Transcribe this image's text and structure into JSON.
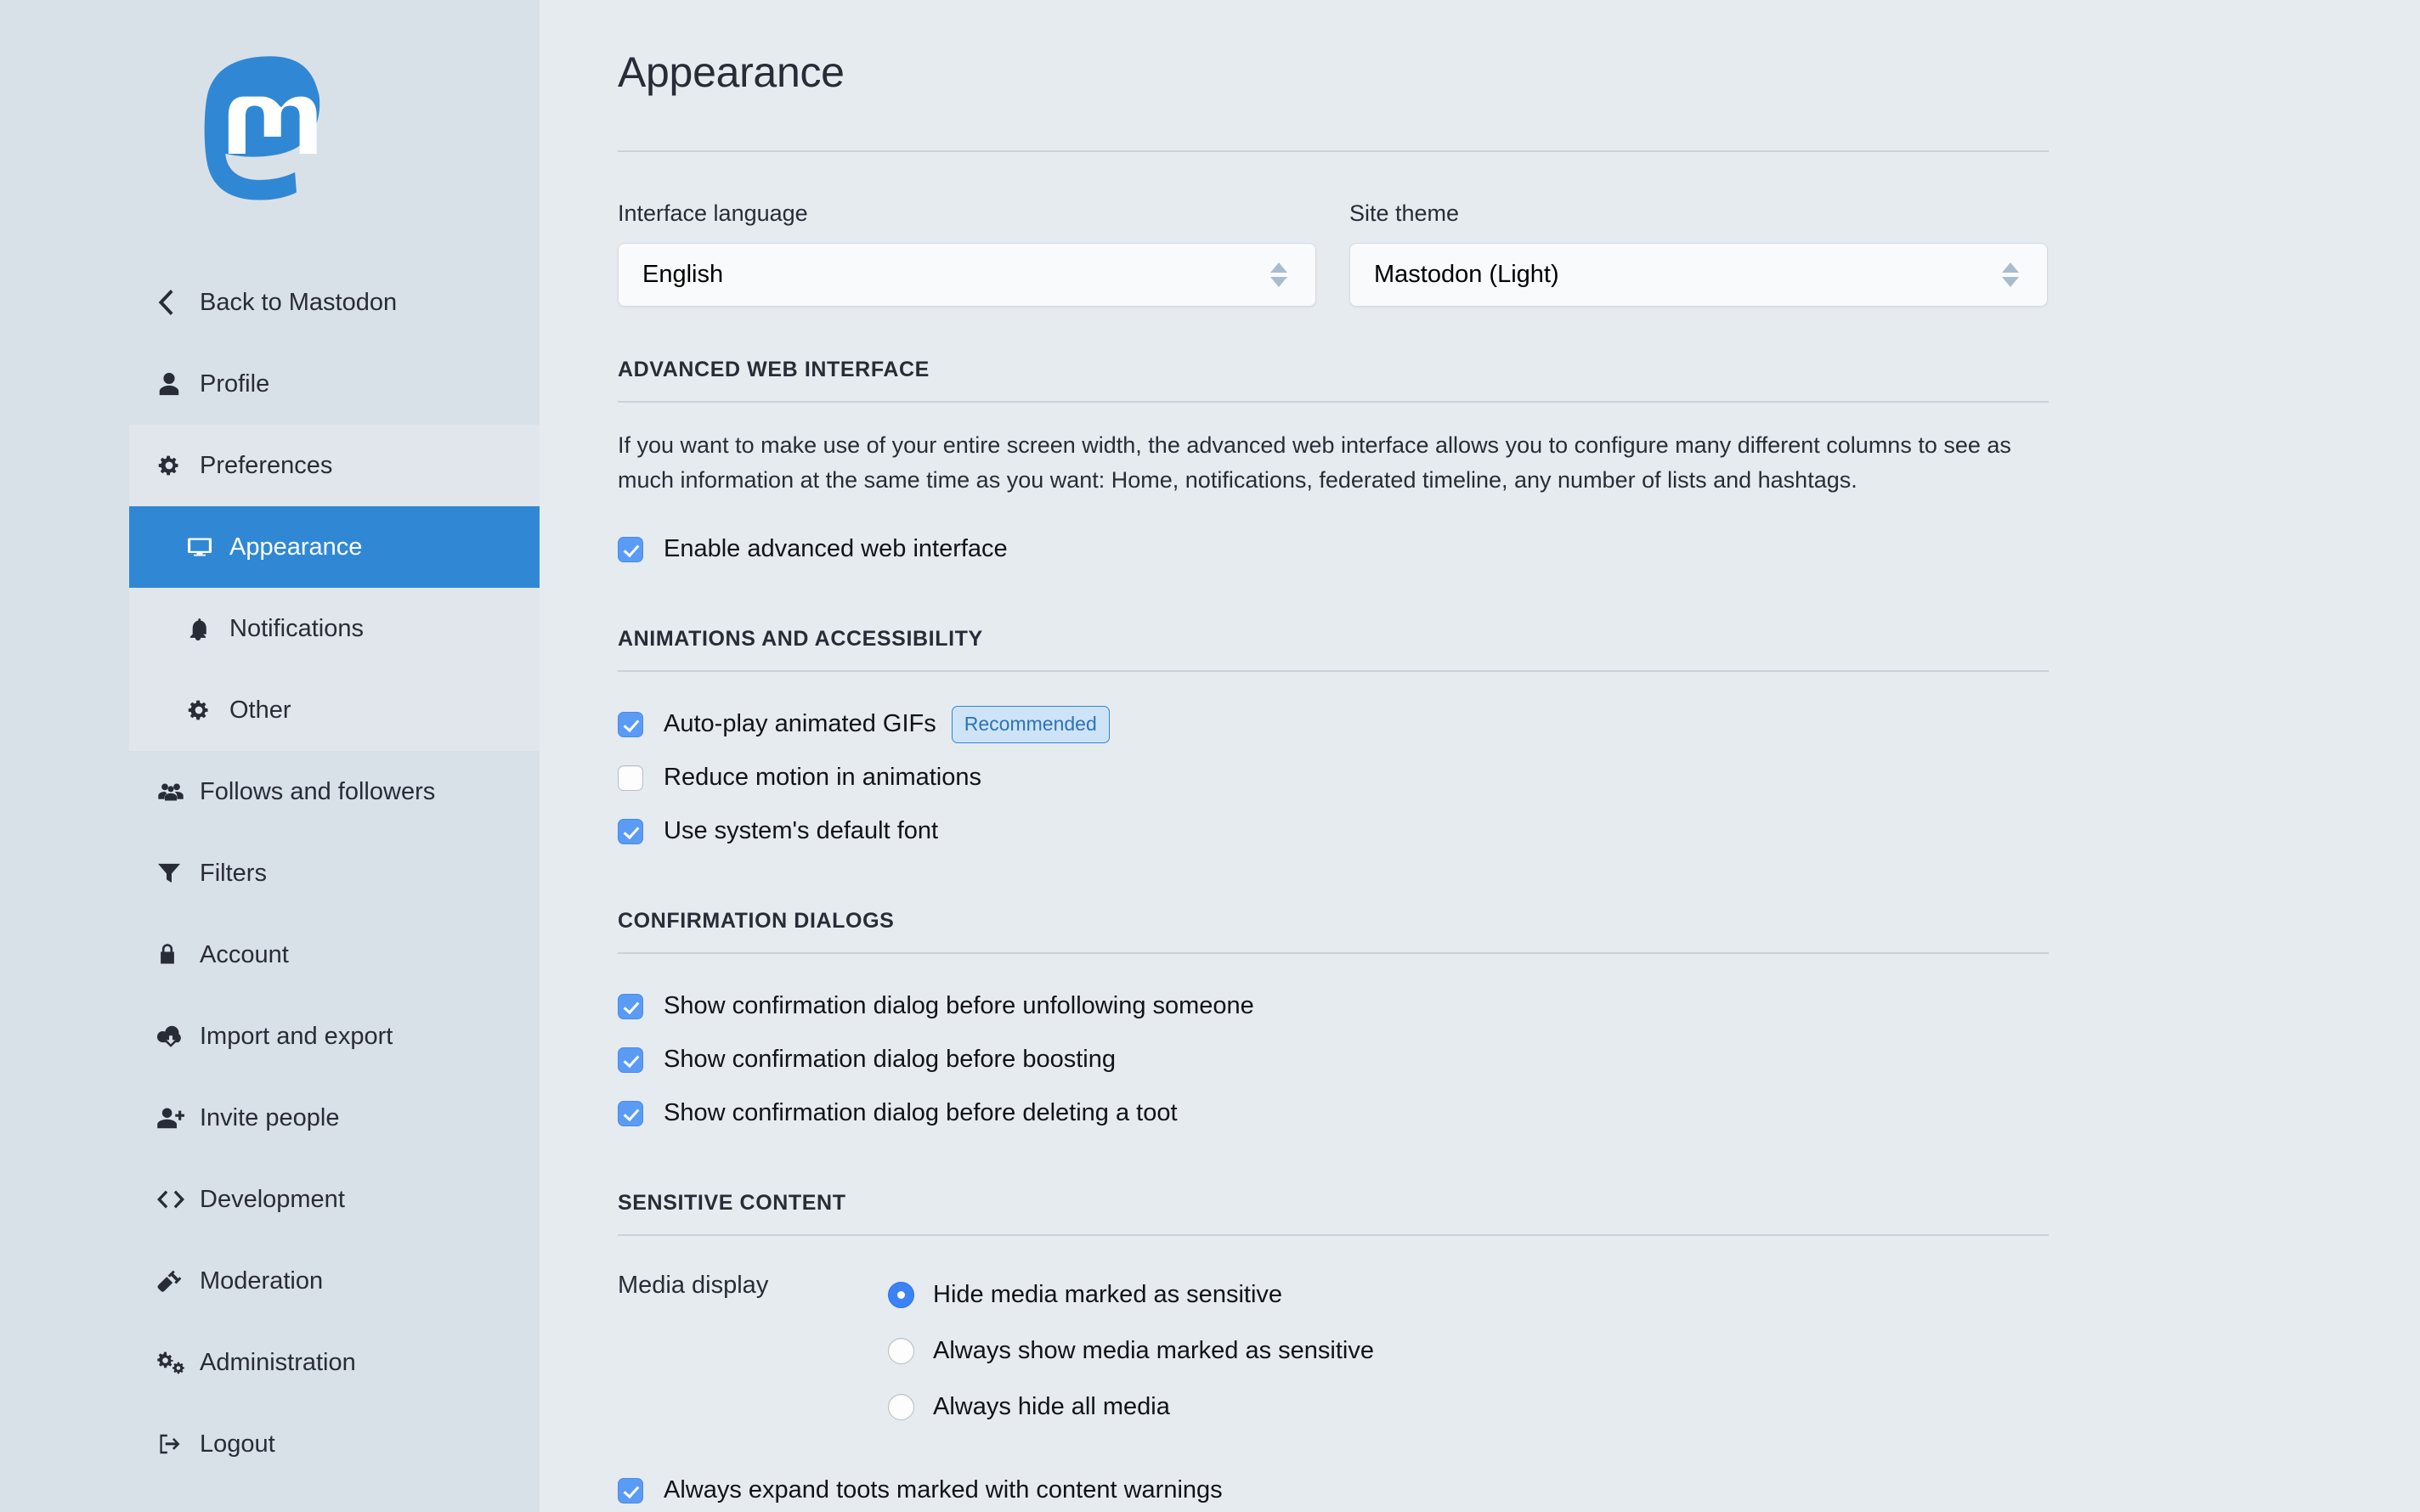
{
  "brand": {
    "logo_name": "mastodon-logo",
    "accent": "#3088d4",
    "sidebar_bg": "#d9e1e8",
    "main_bg": "#e6ebf0"
  },
  "sidebar": {
    "items": [
      {
        "id": "back",
        "label": "Back to Mastodon",
        "icon": "chevron-left-icon",
        "active": false,
        "group": false,
        "sub": false
      },
      {
        "id": "profile",
        "label": "Profile",
        "icon": "user-icon",
        "active": false,
        "group": false,
        "sub": false
      },
      {
        "id": "preferences",
        "label": "Preferences",
        "icon": "gear-icon",
        "active": false,
        "group": true,
        "sub": false
      },
      {
        "id": "appearance",
        "label": "Appearance",
        "icon": "desktop-icon",
        "active": true,
        "group": true,
        "sub": true
      },
      {
        "id": "notifications",
        "label": "Notifications",
        "icon": "bell-icon",
        "active": false,
        "group": true,
        "sub": true
      },
      {
        "id": "other",
        "label": "Other",
        "icon": "gear-icon",
        "active": false,
        "group": true,
        "sub": true
      },
      {
        "id": "follows",
        "label": "Follows and followers",
        "icon": "users-icon",
        "active": false,
        "group": false,
        "sub": false
      },
      {
        "id": "filters",
        "label": "Filters",
        "icon": "filter-icon",
        "active": false,
        "group": false,
        "sub": false
      },
      {
        "id": "account",
        "label": "Account",
        "icon": "lock-icon",
        "active": false,
        "group": false,
        "sub": false
      },
      {
        "id": "import-export",
        "label": "Import and export",
        "icon": "cloud-download-icon",
        "active": false,
        "group": false,
        "sub": false
      },
      {
        "id": "invite",
        "label": "Invite people",
        "icon": "user-plus-icon",
        "active": false,
        "group": false,
        "sub": false
      },
      {
        "id": "development",
        "label": "Development",
        "icon": "code-icon",
        "active": false,
        "group": false,
        "sub": false
      },
      {
        "id": "moderation",
        "label": "Moderation",
        "icon": "gavel-icon",
        "active": false,
        "group": false,
        "sub": false
      },
      {
        "id": "administration",
        "label": "Administration",
        "icon": "cogs-icon",
        "active": false,
        "group": false,
        "sub": false
      },
      {
        "id": "logout",
        "label": "Logout",
        "icon": "sign-out-icon",
        "active": false,
        "group": false,
        "sub": false
      }
    ]
  },
  "page": {
    "title": "Appearance"
  },
  "fields": {
    "interface_language": {
      "label": "Interface language",
      "value": "English"
    },
    "site_theme": {
      "label": "Site theme",
      "value": "Mastodon (Light)"
    }
  },
  "sections": {
    "advanced": {
      "title": "Advanced web interface",
      "description": "If you want to make use of your entire screen width, the advanced web interface allows you to configure many different columns to see as much information at the same time as you want: Home, notifications, federated timeline, any number of lists and hashtags.",
      "options": [
        {
          "label": "Enable advanced web interface",
          "checked": true
        }
      ]
    },
    "animations": {
      "title": "Animations and accessibility",
      "options": [
        {
          "label": "Auto-play animated GIFs",
          "checked": true,
          "badge": "Recommended"
        },
        {
          "label": "Reduce motion in animations",
          "checked": false,
          "badge": null
        },
        {
          "label": "Use system's default font",
          "checked": true,
          "badge": null
        }
      ]
    },
    "confirmation": {
      "title": "Confirmation dialogs",
      "options": [
        {
          "label": "Show confirmation dialog before unfollowing someone",
          "checked": true,
          "badge": null
        },
        {
          "label": "Show confirmation dialog before boosting",
          "checked": true,
          "badge": null
        },
        {
          "label": "Show confirmation dialog before deleting a toot",
          "checked": true,
          "badge": null
        }
      ]
    },
    "sensitive": {
      "title": "Sensitive content",
      "media_display_legend": "Media display",
      "media_display_options": [
        {
          "label": "Hide media marked as sensitive",
          "selected": true
        },
        {
          "label": "Always show media marked as sensitive",
          "selected": false
        },
        {
          "label": "Always hide all media",
          "selected": false
        }
      ],
      "options": [
        {
          "label": "Always expand toots marked with content warnings",
          "checked": true,
          "badge": null
        }
      ]
    }
  }
}
